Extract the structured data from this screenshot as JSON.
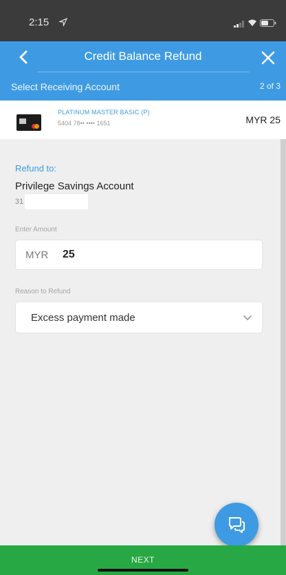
{
  "status_bar": {
    "time": "2:15"
  },
  "header": {
    "title": "Credit Balance Refund"
  },
  "step": {
    "label": "Select Receiving Account",
    "count": "2 of 3"
  },
  "card": {
    "name": "PLATINUM MASTER BASIC (P)",
    "number": "5404 78•• •••• 1651",
    "amount": "MYR 25"
  },
  "refund_to": {
    "label": "Refund to:",
    "account_name": "Privilege Savings Account",
    "account_number": "31"
  },
  "amount_input": {
    "label": "Enter Amount",
    "currency": "MYR",
    "value": "25"
  },
  "reason_select": {
    "label": "Reason to Refund",
    "value": "Excess payment made"
  },
  "footer": {
    "next_label": "NEXT"
  },
  "colors": {
    "accent": "#3e9be3",
    "primary_action": "#27a844",
    "status_bar": "#3b3b3b"
  },
  "icons": [
    "location-arrow-icon",
    "signal-icon",
    "wifi-icon",
    "battery-icon",
    "back-arrow-icon",
    "close-icon",
    "chevron-down-icon",
    "chat-icon"
  ]
}
